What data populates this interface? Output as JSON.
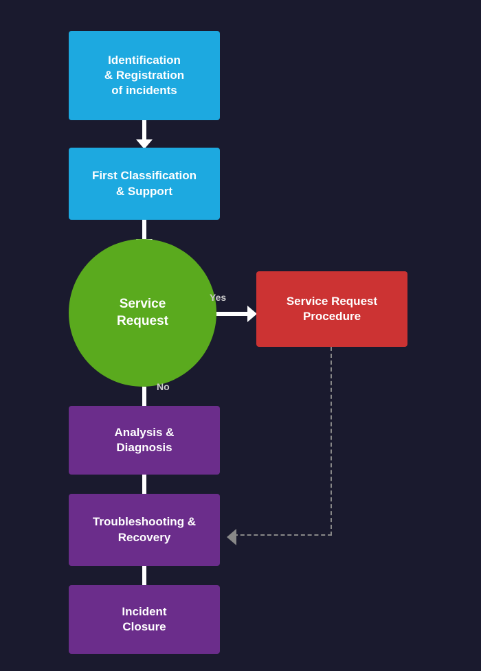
{
  "boxes": {
    "identification": {
      "label": "Identification\n& Registration\nof incidents",
      "color": "blue",
      "lines": [
        "Identification",
        "& Registration",
        "of incidents"
      ]
    },
    "classification": {
      "label": "First Classification\n& Support",
      "color": "blue",
      "lines": [
        "First Classification",
        "& Support"
      ]
    },
    "serviceRequest": {
      "label": "Service\nRequest",
      "color": "green",
      "lines": [
        "Service",
        "Request"
      ]
    },
    "serviceRequestProcedure": {
      "label": "Service Request\nProcedure",
      "color": "red",
      "lines": [
        "Service Request",
        "Procedure"
      ]
    },
    "analysis": {
      "label": "Analysis &\nDiagnosis",
      "color": "purple",
      "lines": [
        "Analysis &",
        "Diagnosis"
      ]
    },
    "troubleshooting": {
      "label": "Troubleshooting &\nRecovery",
      "color": "purple",
      "lines": [
        "Troubleshooting &",
        "Recovery"
      ]
    },
    "closure": {
      "label": "Incident\nClosure",
      "color": "purple",
      "lines": [
        "Incident",
        "Closure"
      ]
    }
  },
  "labels": {
    "yes": "Yes",
    "no": "No"
  }
}
